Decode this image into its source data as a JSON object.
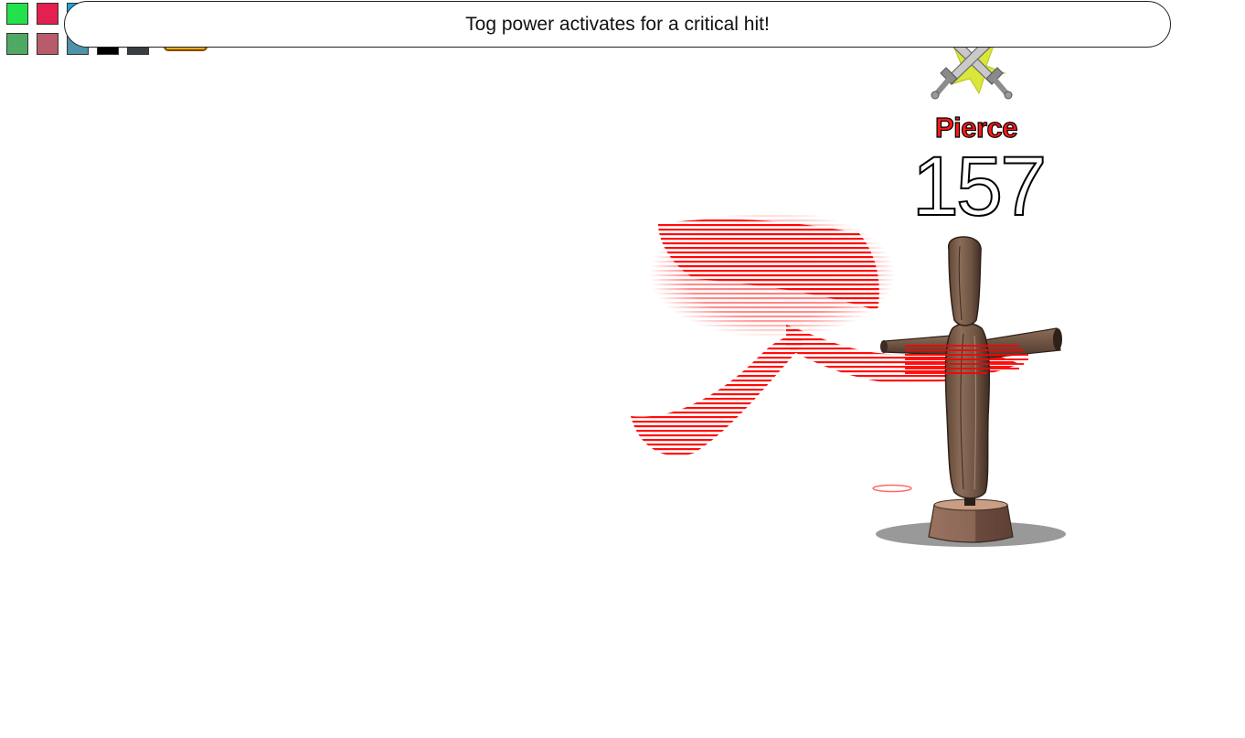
{
  "banner": {
    "message": "Tog power activates for a critical hit!"
  },
  "color_swatches": {
    "row1": [
      {
        "name": "green",
        "color": "#22e14a"
      },
      {
        "name": "crimson",
        "color": "#e3204f"
      },
      {
        "name": "cyan",
        "color": "#19a9d6"
      }
    ],
    "row2": [
      {
        "name": "dark-green",
        "color": "#4fa964"
      },
      {
        "name": "rose",
        "color": "#b85c6c"
      },
      {
        "name": "steel-blue",
        "color": "#4d93aa"
      },
      {
        "name": "black",
        "color": "#000000"
      },
      {
        "name": "charcoal",
        "color": "#3a3d44"
      }
    ]
  },
  "combat": {
    "damage_type": "Pierce",
    "damage_value": "157",
    "critical_icon": "crossed-swords-icon"
  },
  "target": {
    "icon": "training-dummy-icon"
  },
  "colors": {
    "slash_effect": "#ff0000",
    "damage_type_text": "#ff1a1a",
    "hud_button": "#f7a81b"
  }
}
